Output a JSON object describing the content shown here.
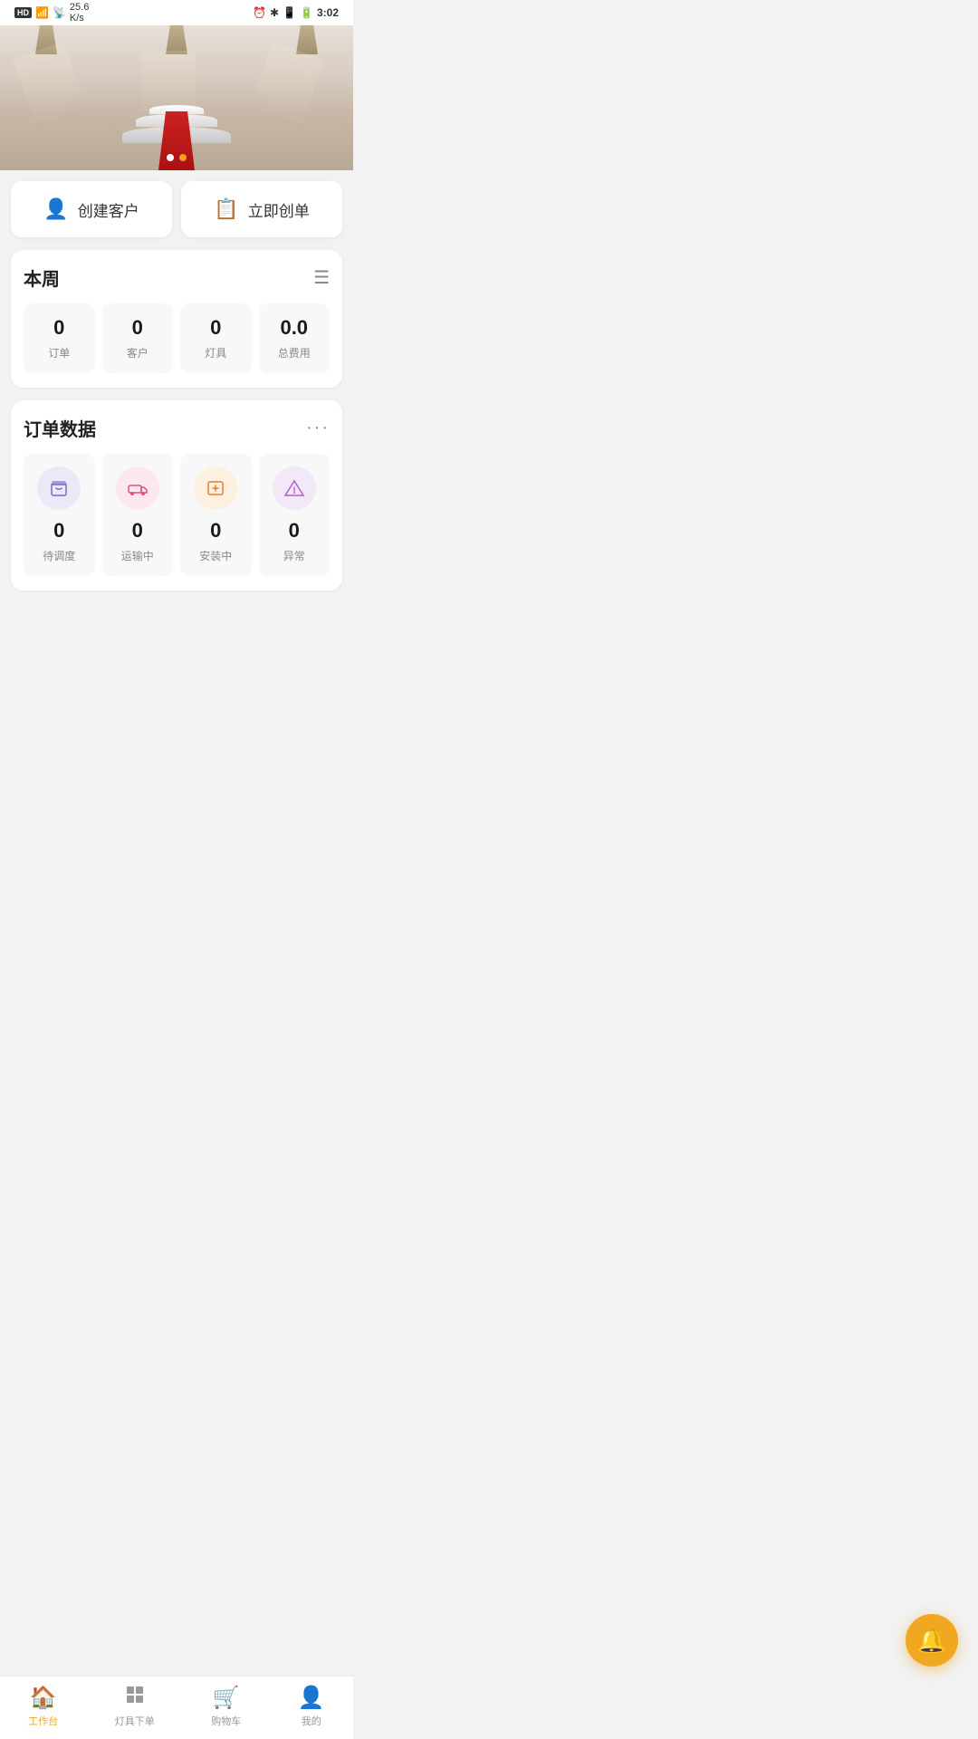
{
  "statusBar": {
    "left": "HD 46 25.6 K/s",
    "right": "3:02"
  },
  "banner": {
    "dots": [
      "active",
      "inactive"
    ]
  },
  "quickActions": [
    {
      "id": "create-customer",
      "label": "创建客户",
      "icon": "👤"
    },
    {
      "id": "create-order",
      "label": "立即创单",
      "icon": "📋"
    }
  ],
  "weekSection": {
    "title": "本周",
    "stats": [
      {
        "value": "0",
        "label": "订单"
      },
      {
        "value": "0",
        "label": "客户"
      },
      {
        "value": "0",
        "label": "灯具"
      },
      {
        "value": "0.0",
        "label": "总费用"
      }
    ]
  },
  "orderSection": {
    "title": "订单数据",
    "items": [
      {
        "value": "0",
        "label": "待调度",
        "iconColor": "purple"
      },
      {
        "value": "0",
        "label": "运输中",
        "iconColor": "pink"
      },
      {
        "value": "0",
        "label": "安装中",
        "iconColor": "orange"
      },
      {
        "value": "0",
        "label": "异常",
        "iconColor": "violet"
      }
    ]
  },
  "fab": {
    "label": "🔔"
  },
  "bottomNav": [
    {
      "id": "workbench",
      "label": "工作台",
      "icon": "🏠",
      "active": true
    },
    {
      "id": "order-lights",
      "label": "灯具下单",
      "icon": "⊞",
      "active": false
    },
    {
      "id": "cart",
      "label": "购物车",
      "icon": "🛒",
      "active": false
    },
    {
      "id": "mine",
      "label": "我的",
      "icon": "👤",
      "active": false
    }
  ]
}
